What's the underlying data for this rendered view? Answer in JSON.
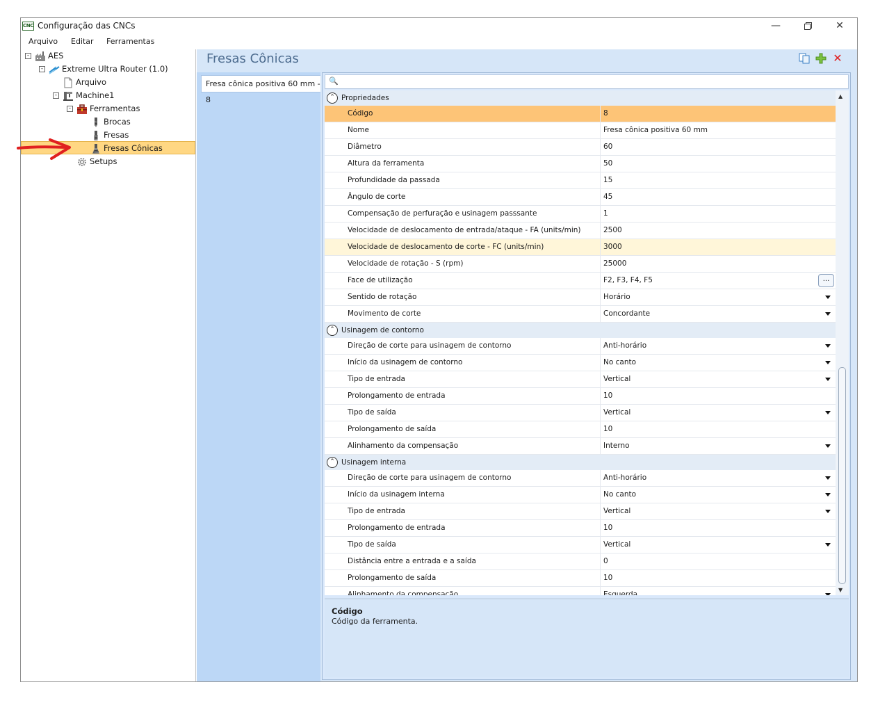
{
  "window": {
    "title": "Configuração das CNCs",
    "app_icon_text": "CNC"
  },
  "menu": [
    "Arquivo",
    "Editar",
    "Ferramentas"
  ],
  "tree": {
    "root": "AES",
    "router": "Extreme Ultra Router (1.0)",
    "arquivo": "Arquivo",
    "machine": "Machine1",
    "ferramentas": "Ferramentas",
    "brocas": "Brocas",
    "fresas": "Fresas",
    "fresas_conicas": "Fresas Cônicas",
    "setups": "Setups"
  },
  "panel": {
    "heading": "Fresas Cônicas",
    "list_items": [
      "Fresa cônica positiva 60 mm - 8"
    ]
  },
  "categories": {
    "propriedades": "Propriedades",
    "contorno": "Usinagem de contorno",
    "interna": "Usinagem interna"
  },
  "rows": [
    {
      "name": "Código",
      "value": "8"
    },
    {
      "name": "Nome",
      "value": "Fresa cônica positiva 60 mm"
    },
    {
      "name": "Diâmetro",
      "value": "60"
    },
    {
      "name": "Altura da ferramenta",
      "value": "50"
    },
    {
      "name": "Profundidade da passada",
      "value": "15"
    },
    {
      "name": "Ângulo de corte",
      "value": "45"
    },
    {
      "name": "Compensação de perfuração e usinagem passsante",
      "value": "1"
    },
    {
      "name": "Velocidade de deslocamento de entrada/ataque - FA (units/min)",
      "value": "2500"
    },
    {
      "name": "Velocidade de deslocamento de corte - FC (units/min)",
      "value": "3000"
    },
    {
      "name": "Velocidade de rotação - S (rpm)",
      "value": "25000"
    },
    {
      "name": "Face de utilização",
      "value": "F2, F3, F4, F5"
    },
    {
      "name": "Sentido de rotação",
      "value": "Horário"
    },
    {
      "name": "Movimento de corte",
      "value": "Concordante"
    },
    {
      "name": "Direção de corte para usinagem de contorno",
      "value": "Anti-horário"
    },
    {
      "name": "Início da usinagem de contorno",
      "value": "No canto"
    },
    {
      "name": "Tipo de entrada",
      "value": "Vertical"
    },
    {
      "name": "Prolongamento de entrada",
      "value": "10"
    },
    {
      "name": "Tipo de saída",
      "value": "Vertical"
    },
    {
      "name": "Prolongamento de saída",
      "value": "10"
    },
    {
      "name": "Alinhamento da compensação",
      "value": "Interno"
    },
    {
      "name": "Direção de corte para usinagem de contorno",
      "value": "Anti-horário"
    },
    {
      "name": "Início da usinagem interna",
      "value": "No canto"
    },
    {
      "name": "Tipo de entrada",
      "value": "Vertical"
    },
    {
      "name": "Prolongamento de entrada",
      "value": "10"
    },
    {
      "name": "Tipo de saída",
      "value": "Vertical"
    },
    {
      "name": "Distância entre a entrada e a saída",
      "value": "0"
    },
    {
      "name": "Prolongamento de saída",
      "value": "10"
    },
    {
      "name": "Alinhamento da compensação",
      "value": "Esquerda"
    }
  ],
  "ellipsis_label": "...",
  "description": {
    "title": "Código",
    "text": "Código da ferramenta."
  },
  "colors": {
    "accent_red": "#e02020",
    "selection": "#fdc477",
    "panel_bg": "#d6e6f8",
    "heading": "#4c6b8e"
  }
}
